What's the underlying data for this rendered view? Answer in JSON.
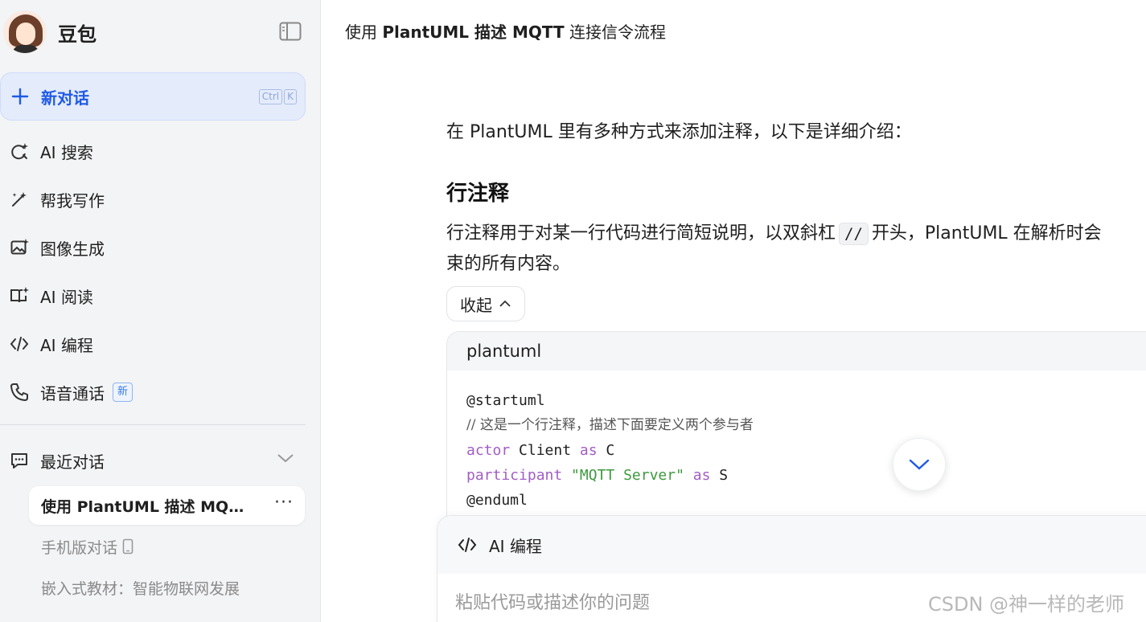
{
  "sidebar": {
    "brand_name": "豆包",
    "new_chat": {
      "label": "新对话",
      "shortcut": [
        "Ctrl",
        "K"
      ]
    },
    "nav": [
      {
        "label": "AI 搜索"
      },
      {
        "label": "帮我写作"
      },
      {
        "label": "图像生成"
      },
      {
        "label": "AI 阅读"
      },
      {
        "label": "AI 编程"
      },
      {
        "label": "语音通话",
        "badge": "新"
      }
    ],
    "recent": {
      "label": "最近对话",
      "items": [
        {
          "title": "使用 PlantUML 描述 MQTT ...",
          "more": "···"
        },
        {
          "title": "手机版对话"
        },
        {
          "title": "嵌入式教材：智能物联网发展"
        }
      ]
    }
  },
  "main": {
    "conversation_title_plain": "使用 ",
    "conversation_title_parts": [
      "使用 ",
      "PlantUML",
      " 描述 ",
      "MQTT",
      " 连接信令流程"
    ],
    "intro": "在 PlantUML 里有多种方式来添加注释，以下是详细介绍：",
    "heading": "行注释",
    "para_part1": "行注释用于对某一行代码进行简短说明，以双斜杠",
    "para_code": "//",
    "para_part2": "开头，PlantUML 在解析时会",
    "para_line2": "束的所有内容。",
    "collapse_label": "收起",
    "code": {
      "language": "plantuml",
      "lines": {
        "l1": "@startuml",
        "l2": "// 这是一个行注释，描述下面要定义两个参与者",
        "l3_kw": "actor",
        "l3_a": " Client ",
        "l3_kw2": "as",
        "l3_b": " C",
        "l4_kw": "participant",
        "l4_str": " \"MQTT Server\" ",
        "l4_kw2": "as",
        "l4_b": " S",
        "l5": "@enduml"
      }
    },
    "composer": {
      "mode_label": "AI 编程",
      "placeholder": "粘贴代码或描述你的问题"
    }
  },
  "watermark": "CSDN @神一样的老师",
  "colors": {
    "accent": "#1f5ae6",
    "keyword": "#a15ec4",
    "string": "#3d9a3d"
  }
}
